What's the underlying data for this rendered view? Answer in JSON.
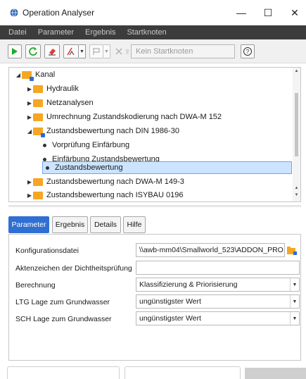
{
  "window": {
    "title": "Operation Analyser",
    "minimize_glyph": "—",
    "maximize_glyph": "☐",
    "close_glyph": "✕"
  },
  "menu": {
    "items": [
      "Datei",
      "Parameter",
      "Ergebnis",
      "Startknoten"
    ]
  },
  "toolbar": {
    "start_node_placeholder": "Kein Startknoten",
    "icons": [
      "play-icon",
      "refresh-icon",
      "eraser-icon",
      "pipe-selection-icon",
      "flag-icon",
      "delete-icon",
      "pin-icon",
      "help-icon"
    ]
  },
  "tree": {
    "items": [
      {
        "label": "Kanal",
        "expander": "◢"
      },
      {
        "label": "Hydraulik",
        "expander": "▶"
      },
      {
        "label": "Netzanalysen",
        "expander": "▶"
      },
      {
        "label": "Umrechnung Zustandskodierung nach DWA-M 152",
        "expander": "▶"
      },
      {
        "label": "Zustandsbewertung nach DIN 1986-30",
        "expander": "◢"
      },
      {
        "label": "Vorprüfung Einfärbung"
      },
      {
        "label": "Einfärbung Zustandsbewertung"
      },
      {
        "label": "Zustandsbewertung"
      },
      {
        "label": "Zustandsbewertung nach DWA-M 149-3",
        "expander": "▶"
      },
      {
        "label": "Zustandsbewertung nach ISYBAU 0196",
        "expander": "▶"
      }
    ],
    "selected": "Zustandsbewertung"
  },
  "tabs": [
    "Parameter",
    "Ergebnis",
    "Details",
    "Hilfe"
  ],
  "active_tab": "Parameter",
  "form": {
    "config_file": {
      "label": "Konfigurationsdatei",
      "value": "\\\\awb-mm04\\Smallworld_523\\ADDON_PRO"
    },
    "seal_test_ref": {
      "label": "Aktenzeichen der Dichtheitsprüfung",
      "value": ""
    },
    "calculation": {
      "label": "Berechnung",
      "value": "Klassifizierung & Priorisierung"
    },
    "ltg_groundwater": {
      "label": "LTG Lage zum Grundwasser",
      "value": "ungünstigster Wert"
    },
    "sch_groundwater": {
      "label": "SCH Lage zum Grundwasser",
      "value": "ungünstigster Wert"
    }
  },
  "colors": {
    "menubar_bg": "#3c3c3c",
    "accent": "#2f6fd1",
    "folder": "#f5a623",
    "selection_bg": "#cce4ff",
    "play": "#1faa2a"
  }
}
